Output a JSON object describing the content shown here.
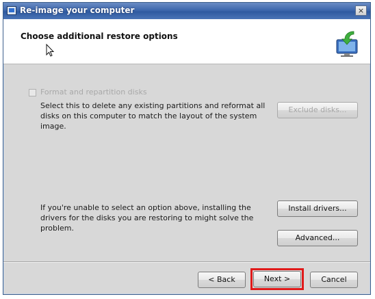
{
  "window": {
    "title": "Re-image your computer",
    "close_glyph": "×"
  },
  "header": {
    "title": "Choose additional restore options",
    "icon": "restore-computer-icon"
  },
  "options": {
    "format_checkbox_label": "Format and repartition disks",
    "format_checked": false,
    "format_enabled": false,
    "format_description": "Select this to delete any existing partitions and reformat all disks on this computer to match the layout of the system image.",
    "exclude_disks_label": "Exclude disks...",
    "drivers_description": "If you're unable to select an option above, installing the drivers for the disks you are restoring to might solve the problem.",
    "install_drivers_label": "Install drivers...",
    "advanced_label": "Advanced..."
  },
  "footer": {
    "back_label": "< Back",
    "next_label": "Next >",
    "cancel_label": "Cancel"
  },
  "colors": {
    "highlight": "#e01a1a",
    "titlebar": "#3e68ad"
  }
}
